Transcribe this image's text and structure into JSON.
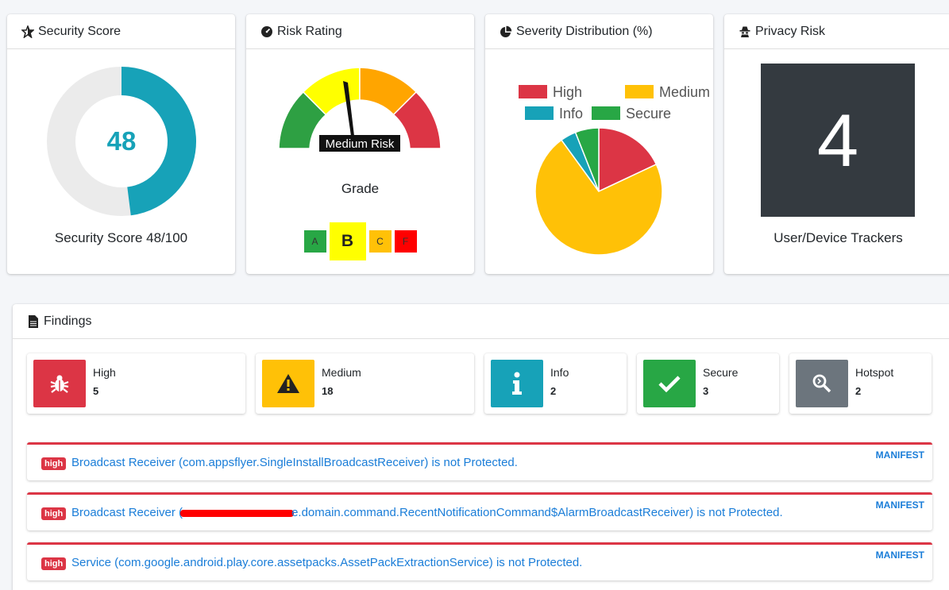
{
  "security": {
    "title": "Security Score",
    "score": "48",
    "caption": "Security Score 48/100",
    "score_fraction": 0.48,
    "color": "#17a2b8"
  },
  "risk": {
    "title": "Risk Rating",
    "gauge_label": "Medium Risk",
    "grade_title": "Grade",
    "grades": [
      {
        "letter": "A",
        "color": "#28a745"
      },
      {
        "letter": "B",
        "color": "#ffff00"
      },
      {
        "letter": "C",
        "color": "#ffc107"
      },
      {
        "letter": "F",
        "color": "#ff0000"
      }
    ],
    "selected_grade": "B"
  },
  "severity": {
    "title": "Severity Distribution (%)",
    "chart_data": {
      "type": "pie",
      "legend": [
        "High",
        "Medium",
        "Info",
        "Secure"
      ],
      "values": [
        18,
        72,
        4,
        6
      ],
      "colors": [
        "#dc3545",
        "#ffc107",
        "#17a2b8",
        "#28a745"
      ],
      "legend_position": "top"
    }
  },
  "privacy": {
    "title": "Privacy Risk",
    "trackers": "4",
    "caption": "User/Device Trackers"
  },
  "findings": {
    "title": "Findings",
    "stats": [
      {
        "label": "High",
        "count": "5",
        "color": "#dc3545",
        "icon": "bug-icon"
      },
      {
        "label": "Medium",
        "count": "18",
        "color": "#ffc107",
        "icon": "warning-icon"
      },
      {
        "label": "Info",
        "count": "2",
        "color": "#17a2b8",
        "icon": "info-icon"
      },
      {
        "label": "Secure",
        "count": "3",
        "color": "#28a745",
        "icon": "check-icon"
      },
      {
        "label": "Hotspot",
        "count": "2",
        "color": "#6c757d",
        "icon": "search-icon"
      }
    ],
    "items": [
      {
        "badge": "high",
        "text": "Broadcast Receiver (com.appsflyer.SingleInstallBroadcastReceiver) is not Protected.",
        "tag": "MANIFEST"
      },
      {
        "badge": "high",
        "text": "Broadcast Receiver (",
        "text_tail": "e.domain.command.RecentNotificationCommand$AlarmBroadcastReceiver) is not Protected.",
        "tag": "MANIFEST"
      },
      {
        "badge": "high",
        "text": "Service (com.google.android.play.core.assetpacks.AssetPackExtractionService) is not Protected.",
        "tag": "MANIFEST"
      }
    ]
  }
}
